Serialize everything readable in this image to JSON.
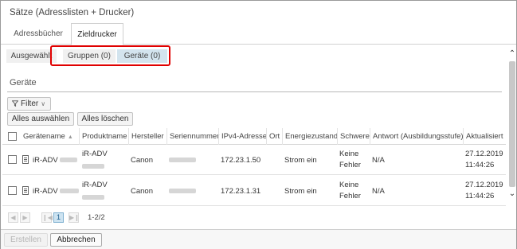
{
  "window": {
    "title": "Sätze (Adresslisten + Drucker)"
  },
  "tabs": [
    {
      "label": "Adressbücher"
    },
    {
      "label": "Zieldrucker"
    }
  ],
  "subtabs": [
    {
      "label": "Ausgewählt"
    },
    {
      "label": "Gruppen (0)"
    },
    {
      "label": "Geräte (0)"
    }
  ],
  "section": {
    "title": "Geräte"
  },
  "toolbar": {
    "filter_label": "Filter",
    "select_all_label": "Alles auswählen",
    "clear_all_label": "Alles löschen"
  },
  "table": {
    "columns": [
      "Gerätename",
      "Produktname",
      "Hersteller",
      "Seriennummer",
      "IPv4-Adresse",
      "Ort",
      "Energiezustand",
      "Schwere",
      "Antwort (Ausbildungsstufe)",
      "Aktualisiert"
    ],
    "rows": [
      {
        "device_name": "iR-ADV",
        "product_name": "iR-ADV",
        "manufacturer": "Canon",
        "ipv4": "172.23.1.50",
        "power_state": "Strom ein",
        "severity_line1": "Keine",
        "severity_line2": "Fehler",
        "response": "N/A",
        "updated_date": "27.12.2019",
        "updated_time": "11:44:26"
      },
      {
        "device_name": "iR-ADV",
        "product_name": "iR-ADV",
        "manufacturer": "Canon",
        "ipv4": "172.23.1.31",
        "power_state": "Strom ein",
        "severity_line1": "Keine",
        "severity_line2": "Fehler",
        "response": "N/A",
        "updated_date": "27.12.2019",
        "updated_time": "11:44:26"
      }
    ]
  },
  "pager": {
    "current_page": "1",
    "range_text": "1-2/2"
  },
  "footer": {
    "create_label": "Erstellen",
    "cancel_label": "Abbrechen"
  },
  "colors": {
    "highlight": "#e00000",
    "active_subtab": "#d3e4ee",
    "active_page": "#cde3f1"
  }
}
